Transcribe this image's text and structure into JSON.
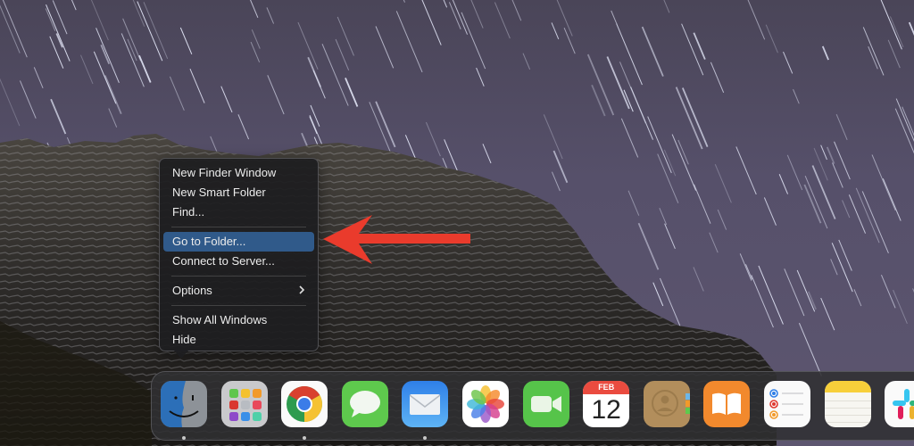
{
  "context_menu": {
    "items": [
      {
        "label": "New Finder Window"
      },
      {
        "label": "New Smart Folder"
      },
      {
        "label": "Find..."
      },
      {
        "label": "Go to Folder...",
        "highlighted": true
      },
      {
        "label": "Connect to Server..."
      },
      {
        "label": "Options",
        "has_submenu": true
      },
      {
        "label": "Show All Windows"
      },
      {
        "label": "Hide"
      }
    ],
    "submenu_icon": "chevron-right-icon",
    "highlight_color": "#305a8a"
  },
  "annotation": {
    "type": "arrow",
    "color": "#ea3b2c",
    "points_to": "Go to Folder..."
  },
  "dock": {
    "apps": [
      {
        "name": "Finder",
        "icon": "finder-icon",
        "running": true
      },
      {
        "name": "Launchpad",
        "icon": "launchpad-icon",
        "running": false
      },
      {
        "name": "Google Chrome",
        "icon": "chrome-icon",
        "running": true
      },
      {
        "name": "Messages",
        "icon": "messages-icon",
        "running": false
      },
      {
        "name": "Mail",
        "icon": "mail-icon",
        "running": true
      },
      {
        "name": "Photos",
        "icon": "photos-icon",
        "running": false
      },
      {
        "name": "FaceTime",
        "icon": "facetime-icon",
        "running": false
      },
      {
        "name": "Calendar",
        "icon": "calendar-icon",
        "running": false,
        "month": "FEB",
        "day": "12"
      },
      {
        "name": "Contacts",
        "icon": "contacts-icon",
        "running": false
      },
      {
        "name": "Books",
        "icon": "books-icon",
        "running": false
      },
      {
        "name": "Reminders",
        "icon": "reminders-icon",
        "running": false
      },
      {
        "name": "Notes",
        "icon": "notes-icon",
        "running": false
      },
      {
        "name": "Slack",
        "icon": "slack-icon",
        "running": false
      }
    ]
  }
}
